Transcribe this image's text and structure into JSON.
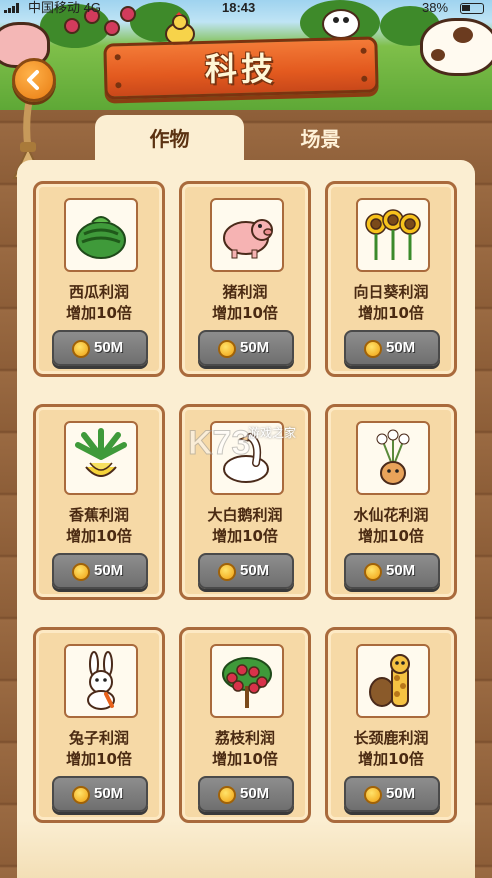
{
  "status_bar": {
    "carrier": "中国移动 4G",
    "time": "18:43",
    "battery": "38%"
  },
  "header": {
    "title": "科技",
    "back_icon": "back-arrow-icon"
  },
  "tabs": [
    {
      "label": "作物",
      "active": true
    },
    {
      "label": "场景",
      "active": false
    }
  ],
  "cards": [
    {
      "name": "西瓜利润",
      "effect": "增加10倍",
      "cost": "50M",
      "icon": "watermelon-icon"
    },
    {
      "name": "猪利润",
      "effect": "增加10倍",
      "cost": "50M",
      "icon": "pig-icon"
    },
    {
      "name": "向日葵利润",
      "effect": "增加10倍",
      "cost": "50M",
      "icon": "sunflower-icon"
    },
    {
      "name": "香蕉利润",
      "effect": "增加10倍",
      "cost": "50M",
      "icon": "banana-icon"
    },
    {
      "name": "大白鹅利润",
      "effect": "增加10倍",
      "cost": "50M",
      "icon": "goose-icon"
    },
    {
      "name": "水仙花利润",
      "effect": "增加10倍",
      "cost": "50M",
      "icon": "narcissus-icon"
    },
    {
      "name": "兔子利润",
      "effect": "增加10倍",
      "cost": "50M",
      "icon": "rabbit-icon"
    },
    {
      "name": "荔枝利润",
      "effect": "增加10倍",
      "cost": "50M",
      "icon": "lychee-icon"
    },
    {
      "name": "长颈鹿利润",
      "effect": "增加10倍",
      "cost": "50M",
      "icon": "giraffe-icon"
    }
  ],
  "watermark": {
    "logo": "K73",
    "text": "游戏之家"
  },
  "colors": {
    "panel": "#fbeed2",
    "card": "#f6d9a6",
    "banner": "#e35a1f",
    "cost_button": "#7d7d7d",
    "coin": "#f5b81c"
  }
}
